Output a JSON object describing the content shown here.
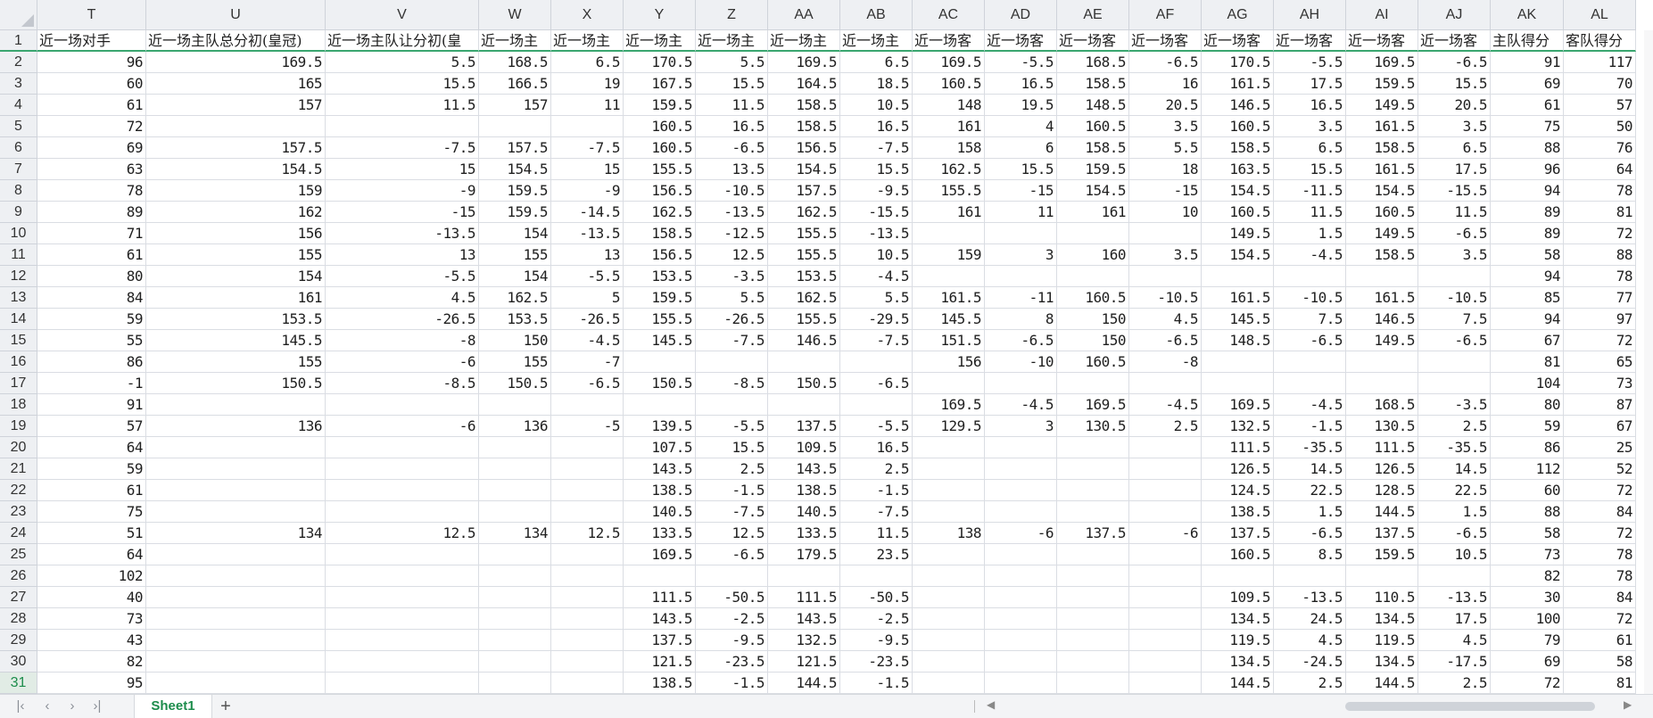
{
  "columns": [
    {
      "letter": "T"
    },
    {
      "letter": "U"
    },
    {
      "letter": "V"
    },
    {
      "letter": "W"
    },
    {
      "letter": "X"
    },
    {
      "letter": "Y"
    },
    {
      "letter": "Z"
    },
    {
      "letter": "AA"
    },
    {
      "letter": "AB"
    },
    {
      "letter": "AC"
    },
    {
      "letter": "AD"
    },
    {
      "letter": "AE"
    },
    {
      "letter": "AF"
    },
    {
      "letter": "AG"
    },
    {
      "letter": "AH"
    },
    {
      "letter": "AI"
    },
    {
      "letter": "AJ"
    },
    {
      "letter": "AK"
    },
    {
      "letter": "AL"
    }
  ],
  "rows": [
    {
      "num": "1",
      "cells": [
        "近一场对手",
        "近一场主队总分初(皇冠)",
        "近一场主队让分初(皇",
        "近一场主",
        "近一场主",
        "近一场主",
        "近一场主",
        "近一场主",
        "近一场主",
        "近一场客",
        "近一场客",
        "近一场客",
        "近一场客",
        "近一场客",
        "近一场客",
        "近一场客",
        "近一场客",
        "主队得分",
        "客队得分"
      ]
    },
    {
      "num": "2",
      "cells": [
        "96",
        "169.5",
        "5.5",
        "168.5",
        "6.5",
        "170.5",
        "5.5",
        "169.5",
        "6.5",
        "169.5",
        "-5.5",
        "168.5",
        "-6.5",
        "170.5",
        "-5.5",
        "169.5",
        "-6.5",
        "91",
        "117"
      ]
    },
    {
      "num": "3",
      "cells": [
        "60",
        "165",
        "15.5",
        "166.5",
        "19",
        "167.5",
        "15.5",
        "164.5",
        "18.5",
        "160.5",
        "16.5",
        "158.5",
        "16",
        "161.5",
        "17.5",
        "159.5",
        "15.5",
        "69",
        "70"
      ]
    },
    {
      "num": "4",
      "cells": [
        "61",
        "157",
        "11.5",
        "157",
        "11",
        "159.5",
        "11.5",
        "158.5",
        "10.5",
        "148",
        "19.5",
        "148.5",
        "20.5",
        "146.5",
        "16.5",
        "149.5",
        "20.5",
        "61",
        "57"
      ]
    },
    {
      "num": "5",
      "cells": [
        "72",
        "",
        "",
        "",
        "",
        "160.5",
        "16.5",
        "158.5",
        "16.5",
        "161",
        "4",
        "160.5",
        "3.5",
        "160.5",
        "3.5",
        "161.5",
        "3.5",
        "75",
        "50"
      ]
    },
    {
      "num": "6",
      "cells": [
        "69",
        "157.5",
        "-7.5",
        "157.5",
        "-7.5",
        "160.5",
        "-6.5",
        "156.5",
        "-7.5",
        "158",
        "6",
        "158.5",
        "5.5",
        "158.5",
        "6.5",
        "158.5",
        "6.5",
        "88",
        "76"
      ]
    },
    {
      "num": "7",
      "cells": [
        "63",
        "154.5",
        "15",
        "154.5",
        "15",
        "155.5",
        "13.5",
        "154.5",
        "15.5",
        "162.5",
        "15.5",
        "159.5",
        "18",
        "163.5",
        "15.5",
        "161.5",
        "17.5",
        "96",
        "64"
      ]
    },
    {
      "num": "8",
      "cells": [
        "78",
        "159",
        "-9",
        "159.5",
        "-9",
        "156.5",
        "-10.5",
        "157.5",
        "-9.5",
        "155.5",
        "-15",
        "154.5",
        "-15",
        "154.5",
        "-11.5",
        "154.5",
        "-15.5",
        "94",
        "78"
      ]
    },
    {
      "num": "9",
      "cells": [
        "89",
        "162",
        "-15",
        "159.5",
        "-14.5",
        "162.5",
        "-13.5",
        "162.5",
        "-15.5",
        "161",
        "11",
        "161",
        "10",
        "160.5",
        "11.5",
        "160.5",
        "11.5",
        "89",
        "81"
      ]
    },
    {
      "num": "10",
      "cells": [
        "71",
        "156",
        "-13.5",
        "154",
        "-13.5",
        "158.5",
        "-12.5",
        "155.5",
        "-13.5",
        "",
        "",
        "",
        "",
        "149.5",
        "1.5",
        "149.5",
        "-6.5",
        "89",
        "72"
      ]
    },
    {
      "num": "11",
      "cells": [
        "61",
        "155",
        "13",
        "155",
        "13",
        "156.5",
        "12.5",
        "155.5",
        "10.5",
        "159",
        "3",
        "160",
        "3.5",
        "154.5",
        "-4.5",
        "158.5",
        "3.5",
        "58",
        "88"
      ]
    },
    {
      "num": "12",
      "cells": [
        "80",
        "154",
        "-5.5",
        "154",
        "-5.5",
        "153.5",
        "-3.5",
        "153.5",
        "-4.5",
        "",
        "",
        "",
        "",
        "",
        "",
        "",
        "",
        "94",
        "78"
      ]
    },
    {
      "num": "13",
      "cells": [
        "84",
        "161",
        "4.5",
        "162.5",
        "5",
        "159.5",
        "5.5",
        "162.5",
        "5.5",
        "161.5",
        "-11",
        "160.5",
        "-10.5",
        "161.5",
        "-10.5",
        "161.5",
        "-10.5",
        "85",
        "77"
      ]
    },
    {
      "num": "14",
      "cells": [
        "59",
        "153.5",
        "-26.5",
        "153.5",
        "-26.5",
        "155.5",
        "-26.5",
        "155.5",
        "-29.5",
        "145.5",
        "8",
        "150",
        "4.5",
        "145.5",
        "7.5",
        "146.5",
        "7.5",
        "94",
        "97"
      ]
    },
    {
      "num": "15",
      "cells": [
        "55",
        "145.5",
        "-8",
        "150",
        "-4.5",
        "145.5",
        "-7.5",
        "146.5",
        "-7.5",
        "151.5",
        "-6.5",
        "150",
        "-6.5",
        "148.5",
        "-6.5",
        "149.5",
        "-6.5",
        "67",
        "72"
      ]
    },
    {
      "num": "16",
      "cells": [
        "86",
        "155",
        "-6",
        "155",
        "-7",
        "",
        "",
        "",
        "",
        "156",
        "-10",
        "160.5",
        "-8",
        "",
        "",
        "",
        "",
        "81",
        "65"
      ]
    },
    {
      "num": "17",
      "cells": [
        "-1",
        "150.5",
        "-8.5",
        "150.5",
        "-6.5",
        "150.5",
        "-8.5",
        "150.5",
        "-6.5",
        "",
        "",
        "",
        "",
        "",
        "",
        "",
        "",
        "104",
        "73"
      ]
    },
    {
      "num": "18",
      "cells": [
        "91",
        "",
        "",
        "",
        "",
        "",
        "",
        "",
        "",
        "169.5",
        "-4.5",
        "169.5",
        "-4.5",
        "169.5",
        "-4.5",
        "168.5",
        "-3.5",
        "80",
        "87"
      ]
    },
    {
      "num": "19",
      "cells": [
        "57",
        "136",
        "-6",
        "136",
        "-5",
        "139.5",
        "-5.5",
        "137.5",
        "-5.5",
        "129.5",
        "3",
        "130.5",
        "2.5",
        "132.5",
        "-1.5",
        "130.5",
        "2.5",
        "59",
        "67"
      ]
    },
    {
      "num": "20",
      "cells": [
        "64",
        "",
        "",
        "",
        "",
        "107.5",
        "15.5",
        "109.5",
        "16.5",
        "",
        "",
        "",
        "",
        "111.5",
        "-35.5",
        "111.5",
        "-35.5",
        "86",
        "25"
      ]
    },
    {
      "num": "21",
      "cells": [
        "59",
        "",
        "",
        "",
        "",
        "143.5",
        "2.5",
        "143.5",
        "2.5",
        "",
        "",
        "",
        "",
        "126.5",
        "14.5",
        "126.5",
        "14.5",
        "112",
        "52"
      ]
    },
    {
      "num": "22",
      "cells": [
        "61",
        "",
        "",
        "",
        "",
        "138.5",
        "-1.5",
        "138.5",
        "-1.5",
        "",
        "",
        "",
        "",
        "124.5",
        "22.5",
        "128.5",
        "22.5",
        "60",
        "72"
      ]
    },
    {
      "num": "23",
      "cells": [
        "75",
        "",
        "",
        "",
        "",
        "140.5",
        "-7.5",
        "140.5",
        "-7.5",
        "",
        "",
        "",
        "",
        "138.5",
        "1.5",
        "144.5",
        "1.5",
        "88",
        "84"
      ]
    },
    {
      "num": "24",
      "cells": [
        "51",
        "134",
        "12.5",
        "134",
        "12.5",
        "133.5",
        "12.5",
        "133.5",
        "11.5",
        "138",
        "-6",
        "137.5",
        "-6",
        "137.5",
        "-6.5",
        "137.5",
        "-6.5",
        "58",
        "72"
      ]
    },
    {
      "num": "25",
      "cells": [
        "64",
        "",
        "",
        "",
        "",
        "169.5",
        "-6.5",
        "179.5",
        "23.5",
        "",
        "",
        "",
        "",
        "160.5",
        "8.5",
        "159.5",
        "10.5",
        "73",
        "78"
      ]
    },
    {
      "num": "26",
      "cells": [
        "102",
        "",
        "",
        "",
        "",
        "",
        "",
        "",
        "",
        "",
        "",
        "",
        "",
        "",
        "",
        "",
        "",
        "82",
        "78"
      ]
    },
    {
      "num": "27",
      "cells": [
        "40",
        "",
        "",
        "",
        "",
        "111.5",
        "-50.5",
        "111.5",
        "-50.5",
        "",
        "",
        "",
        "",
        "109.5",
        "-13.5",
        "110.5",
        "-13.5",
        "30",
        "84"
      ]
    },
    {
      "num": "28",
      "cells": [
        "73",
        "",
        "",
        "",
        "",
        "143.5",
        "-2.5",
        "143.5",
        "-2.5",
        "",
        "",
        "",
        "",
        "134.5",
        "24.5",
        "134.5",
        "17.5",
        "100",
        "72"
      ]
    },
    {
      "num": "29",
      "cells": [
        "43",
        "",
        "",
        "",
        "",
        "137.5",
        "-9.5",
        "132.5",
        "-9.5",
        "",
        "",
        "",
        "",
        "119.5",
        "4.5",
        "119.5",
        "4.5",
        "79",
        "61"
      ]
    },
    {
      "num": "30",
      "cells": [
        "82",
        "",
        "",
        "",
        "",
        "121.5",
        "-23.5",
        "121.5",
        "-23.5",
        "",
        "",
        "",
        "",
        "134.5",
        "-24.5",
        "134.5",
        "-17.5",
        "69",
        "58"
      ]
    },
    {
      "num": "31",
      "cells": [
        "95",
        "",
        "",
        "",
        "",
        "138.5",
        "-1.5",
        "144.5",
        "-1.5",
        "",
        "",
        "",
        "",
        "144.5",
        "2.5",
        "144.5",
        "2.5",
        "72",
        "81"
      ]
    }
  ],
  "sheet_tabs": [
    "Sheet1"
  ],
  "active_row": "31",
  "accent_color": "#1c8c4b",
  "nav_icons": [
    "first-sheet-icon",
    "prev-sheet-icon",
    "next-sheet-icon",
    "last-sheet-icon"
  ],
  "add_sheet_label": "+"
}
